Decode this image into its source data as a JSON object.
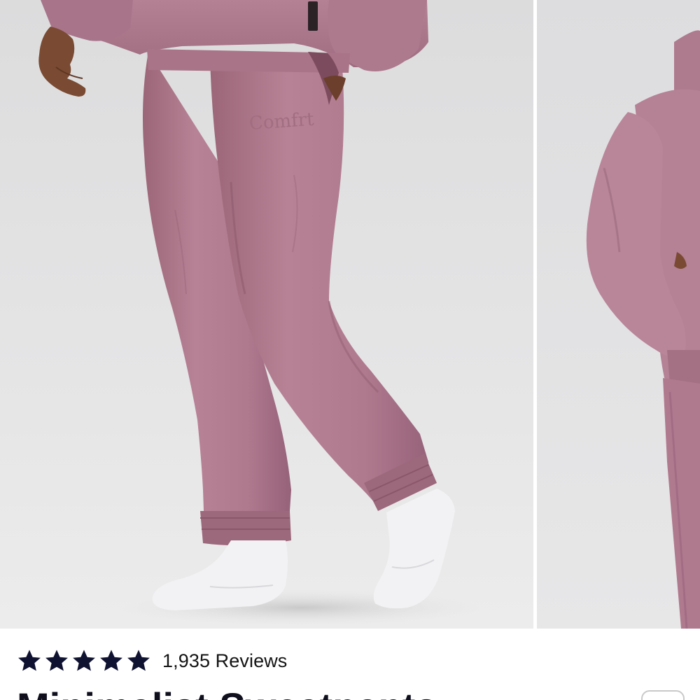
{
  "product": {
    "brand_print": "Comfrt",
    "rating": {
      "stars": 5,
      "max": 5,
      "reviews_label": "1,935 Reviews"
    },
    "title": "Minimalist Sweatpants"
  },
  "colors": {
    "fabric": "#b88296",
    "star": "#0f1230",
    "title": "#0f0f1e"
  },
  "icons": {
    "star": "star-icon",
    "favorite": "heart-icon"
  }
}
